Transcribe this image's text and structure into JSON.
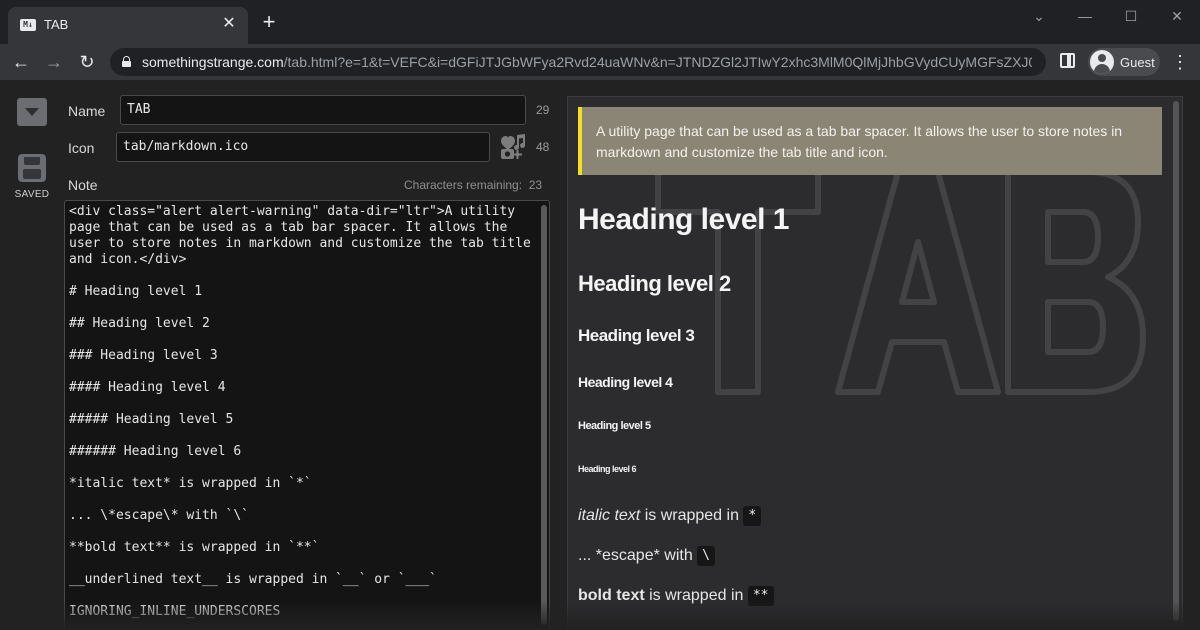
{
  "browser": {
    "tab_title": "TAB",
    "tab_favicon_text": "M↓",
    "url_host": "somethingstrange.com",
    "url_rest": "/tab.html?e=1&t=VEFC&i=dGFiJTJGbWFya2Rvd24uaWNv&n=JTNDZGl2JTIwY2xhc3MlM0QlMjJhbGVydCUyMGFsZXJ0L...",
    "profile_label": "Guest",
    "icons": [
      "back-arrow-icon",
      "forward-arrow-icon",
      "reload-icon",
      "lock-icon",
      "side-panel-icon",
      "more-menu-icon"
    ]
  },
  "editor": {
    "saved_label": "SAVED",
    "name_label": "Name",
    "name_value": "TAB",
    "name_count": "29",
    "icon_label": "Icon",
    "icon_value": "tab/markdown.ico",
    "icon_count": "48",
    "note_label": "Note",
    "chars_remaining_label": "Characters remaining:",
    "chars_remaining_value": "23",
    "note_lines": [
      "<div class=\"alert alert-warning\" data-dir=\"ltr\">A utility page that can be used as a tab bar spacer. It allows the user to store notes in markdown and customize the tab title and icon.</div>",
      "",
      "# Heading level 1",
      "",
      "## Heading level 2",
      "",
      "### Heading level 3",
      "",
      "#### Heading level 4",
      "",
      "##### Heading level 5",
      "",
      "###### Heading level 6",
      "",
      "*italic text* is wrapped in `*`",
      "",
      "... \\*escape\\* with `\\`",
      "",
      "**bold text** is wrapped in `**`",
      "",
      "__underlined text__ is wrapped in `__` or `___`",
      "",
      "IGNORING_INLINE_UNDERSCORES"
    ]
  },
  "preview": {
    "alert_text": "A utility page that can be used as a tab bar spacer. It allows the user to store notes in markdown and customize the tab title and icon.",
    "h1": "Heading level 1",
    "h2": "Heading level 2",
    "h3": "Heading level 3",
    "h4": "Heading level 4",
    "h5": "Heading level 5",
    "h6": "Heading level 6",
    "italic_text": "italic text",
    "italic_rest": " is wrapped in ",
    "italic_code": "*",
    "escape_text": "... *escape* with ",
    "escape_code": "\\",
    "bold_text": "bold text",
    "bold_rest": " is wrapped in ",
    "bold_code": "**",
    "watermark_text": "TAB",
    "colors": {
      "alert_bg": "#8b8576",
      "alert_border": "#f0e020",
      "page_bg": "#222222"
    }
  }
}
